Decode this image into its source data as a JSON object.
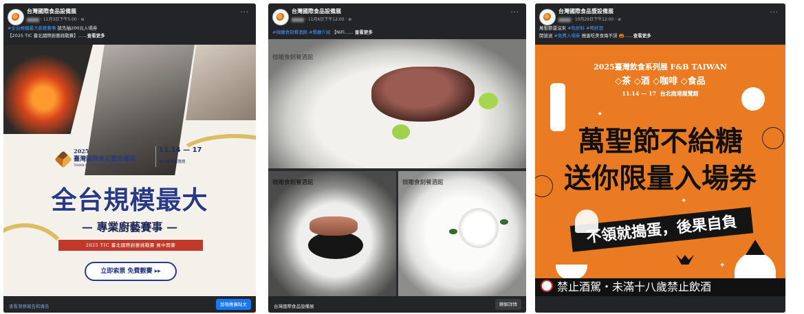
{
  "posts": [
    {
      "page_name": "台灣國際食品設備展",
      "meta_suffix": "· 11月3日下午5:00 · ⊕",
      "more": "···",
      "caption_line1_tag": "#全台規模最大廚藝賽事",
      "caption_line1_rest": " 搶先抽200元入場券",
      "caption_line2": "【2025 TIC 臺北國際廚藝挑戰賽】……",
      "see_more": "查看更多",
      "art": {
        "year": "2025",
        "name": "臺灣國際食品暨設備展",
        "name_en": "TAIWAN INT'L FOOD INDUSTRY SHOW",
        "date": "11.14 — 17",
        "venue": "台北南港展覽館",
        "headline": "全台規模最大",
        "subheadline": "— 專業廚藝賽事 —",
        "red_bar": "2025 TIC 臺北國際廚藝挑戰賽 展中開賽",
        "pill": "立即索票 免費觀賽 ▸▸"
      },
      "footer_text": "查看洞察報告和廣告",
      "footer_button": "加強推廣貼文"
    },
    {
      "page_name": "台灣國際食品設備展",
      "meta_suffix": "· 11月6日下午12:00 · ⊕",
      "more": "···",
      "caption_line1_tag": "#微雕食刻餐酒館 #餐廳介紹",
      "caption_line1_rest": " 【NiFi……",
      "see_more": "查看更多",
      "art": {
        "logo_top": "微雕食刻餐酒館",
        "logo_bl": "微雕食刻餐酒館",
        "logo_br": "微雕食刻餐酒館"
      },
      "footer_text": "台灣國際食品設備展",
      "footer_button": "瞭解詳情"
    },
    {
      "page_name": "台灣國際食品暨設備展",
      "meta_suffix": "· 10月29日下午12:00 · ⊕",
      "more": "···",
      "caption_line1_tag": "#吃好料 #喝好酒",
      "caption_line1_prefix": "萬聖節還沒來 ",
      "caption_line2_prefix": "開搶送 ",
      "caption_line2_tag": "#免費入場券",
      "caption_line2_rest": " 搗蛋吃美食兩不誤 🎃……",
      "see_more": "查看更多",
      "art": {
        "year_title": "2025臺灣飲食系列展 F&B TAIWAN",
        "tags": "◇茶 ◇酒 ◇咖啡 ◇食品",
        "date": "11.14 — 17",
        "venue": "台北南港展覽館",
        "headline1": "萬聖節不給糖",
        "headline2": "送你限量入場券",
        "bar": "不領就搗蛋，後果自負",
        "notice": "禁止酒駕・未滿十八歲禁止飲酒"
      }
    }
  ],
  "colors": {
    "card_bg": "#232427",
    "link_blue": "#4599ff",
    "button_blue": "#1877f2",
    "navy": "#2a3986",
    "orange": "#ea7b22"
  }
}
